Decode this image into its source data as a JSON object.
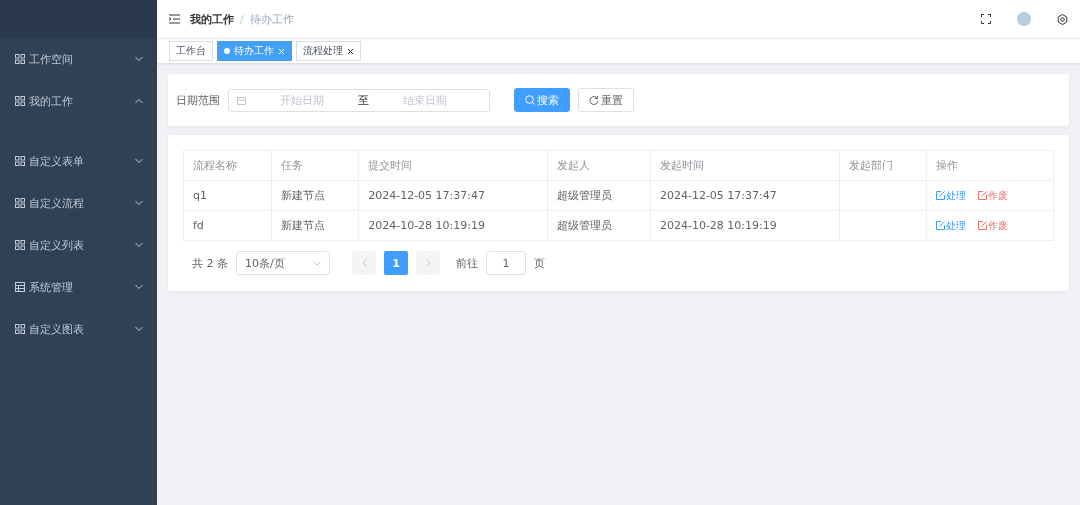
{
  "sidebar": {
    "items": [
      {
        "label": "工作空间",
        "kind": "grid",
        "expanded": false
      },
      {
        "label": "我的工作",
        "kind": "grid",
        "expanded": true
      },
      {
        "label": "自定义表单",
        "kind": "grid",
        "expanded": false
      },
      {
        "label": "自定义流程",
        "kind": "grid",
        "expanded": false
      },
      {
        "label": "自定义列表",
        "kind": "grid",
        "expanded": false
      },
      {
        "label": "系统管理",
        "kind": "table",
        "expanded": false
      },
      {
        "label": "自定义图表",
        "kind": "grid",
        "expanded": false
      }
    ]
  },
  "breadcrumb": {
    "separator": "/",
    "items": [
      "我的工作",
      "待办工作"
    ]
  },
  "tabs": [
    {
      "label": "工作台",
      "selected": false,
      "closable": false
    },
    {
      "label": "待办工作",
      "selected": true,
      "closable": true
    },
    {
      "label": "流程处理",
      "selected": false,
      "closable": true
    }
  ],
  "filter": {
    "label": "日期范围",
    "start_placeholder": "开始日期",
    "separator": "至",
    "end_placeholder": "结束日期",
    "search_button": "搜索",
    "reset_button": "重置"
  },
  "table": {
    "columns": [
      "流程名称",
      "任务",
      "提交时间",
      "发起人",
      "发起时间",
      "发起部门",
      "操作"
    ],
    "rows": [
      {
        "cells": [
          "q1",
          "新建节点",
          "2024-12-05 17:37:47",
          "超级管理员",
          "2024-12-05 17:37:47",
          ""
        ],
        "actions": [
          {
            "label": "处理",
            "kind": "primary"
          },
          {
            "label": "作废",
            "kind": "danger"
          }
        ]
      },
      {
        "cells": [
          "fd",
          "新建节点",
          "2024-10-28 10:19:19",
          "超级管理员",
          "2024-10-28 10:19:19",
          ""
        ],
        "actions": [
          {
            "label": "处理",
            "kind": "primary"
          },
          {
            "label": "作废",
            "kind": "danger"
          }
        ]
      }
    ]
  },
  "pagination": {
    "total": "共 2 条",
    "page_size": "10条/页",
    "pages": [
      {
        "label": "1",
        "selected": true
      }
    ],
    "goto_label": "前往",
    "goto_value": "1",
    "page_unit": "页"
  }
}
